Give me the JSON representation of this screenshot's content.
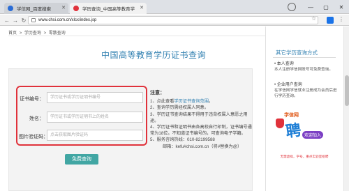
{
  "browser": {
    "tabs": [
      {
        "label": "学信网_百度搜索",
        "favicon_color": "#2a6cd6"
      },
      {
        "label": "学历查询_中国高等教育学",
        "favicon_color": "#e0323b"
      }
    ],
    "url": "www.chsi.com.cn/xlcx/index.jsp",
    "window_controls": [
      "—",
      "▢",
      "✕"
    ]
  },
  "breadcrumb": [
    "首页",
    ">",
    "学历查询",
    ">",
    "零散查询"
  ],
  "page_title": "中国高等教育学历证书查询",
  "form": {
    "fields": [
      {
        "label": "证书编号：",
        "placeholder": "学历证书或学历证明书编号"
      },
      {
        "label": "姓名：",
        "placeholder": "学历证书或学历证明书上的姓名"
      },
      {
        "label": "图片验证码：",
        "placeholder": "点击获取图片验证码"
      }
    ],
    "submit_label": "免费查询"
  },
  "notes": {
    "title": "注意：",
    "items": [
      {
        "prefix": "1、点此查看",
        "link": "学历证书查询范围",
        "suffix": "。"
      },
      {
        "text": "2、查询学历需经权属人同意。"
      },
      {
        "text": "3、学历证书查询结果不得用于违背权属人意愿之用途。"
      },
      {
        "text": "4、学历证书和证明书由各高校自行印制，证书编号通常为18位。不知道证书编号的，可查询电子学籍。"
      },
      {
        "text": "5、服务咨询热线：010-82199588"
      },
      {
        "text": "邮箱：kefu#chsi.com.cn（将#替换为@）"
      }
    ]
  },
  "sidebar": {
    "title": "其它学历查询方式",
    "blocks": [
      {
        "heading": "• 本人查询",
        "text": "本人注册学信网账号可免费查询。"
      },
      {
        "heading": "• 企业用户查询",
        "text": "在学信网学信就业注册成为会员后进行学历查询。"
      }
    ],
    "ad": {
      "logo": "学信网",
      "big": "聘",
      "bubble": "欢迎加入",
      "footer": "无需虚拟，学号，重点实验室招聘"
    }
  },
  "colors": {
    "accent": "#2f7fb0",
    "highlight": "#e0323b",
    "button": "#41a6a3"
  }
}
